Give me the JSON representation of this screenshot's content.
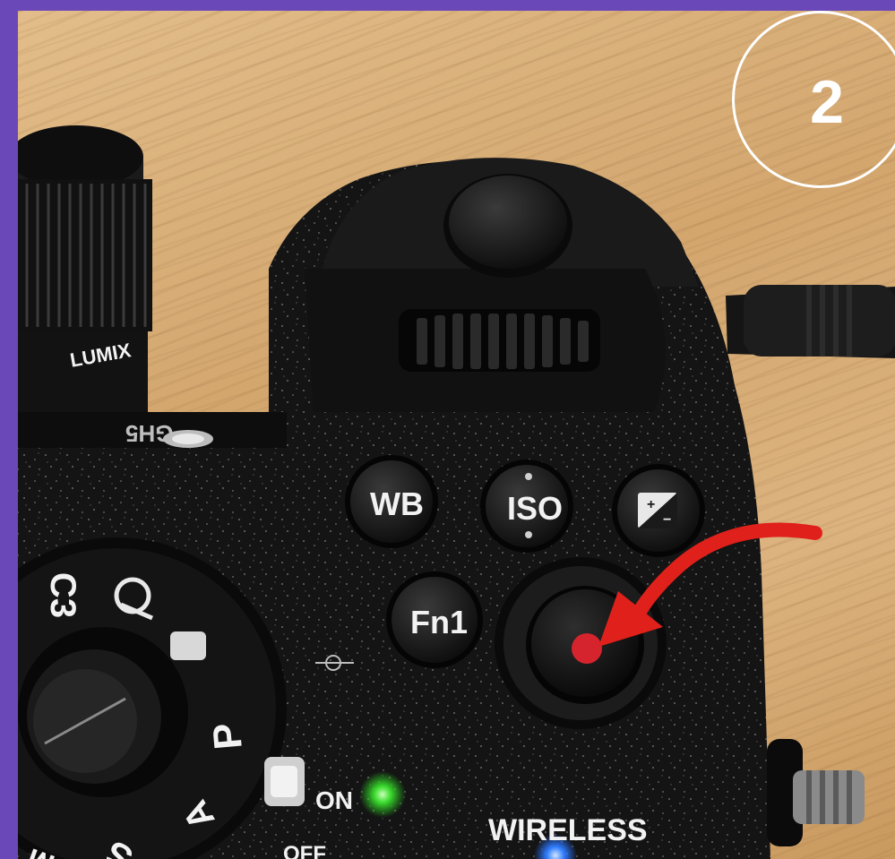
{
  "step_badge": {
    "number": "2"
  },
  "camera": {
    "lens_brand": "LUMIX",
    "model_fragment": "GH5",
    "buttons": {
      "wb": "WB",
      "iso": "ISO",
      "fn1": "Fn1"
    },
    "mode_dial": {
      "c3": "C3",
      "p": "P",
      "a": "A",
      "s": "S",
      "m": "M"
    },
    "power_switch": {
      "on": "ON",
      "off": "OFF"
    },
    "wireless_label": "WIRELESS"
  },
  "annotation": {
    "arrow_color": "#e0201a",
    "arrow_target": "video record button"
  },
  "colors": {
    "frame": "#6a48b8",
    "record_dot": "#d6242e",
    "power_led": "#3bdc2e",
    "wireless_led": "#2f7dff"
  }
}
